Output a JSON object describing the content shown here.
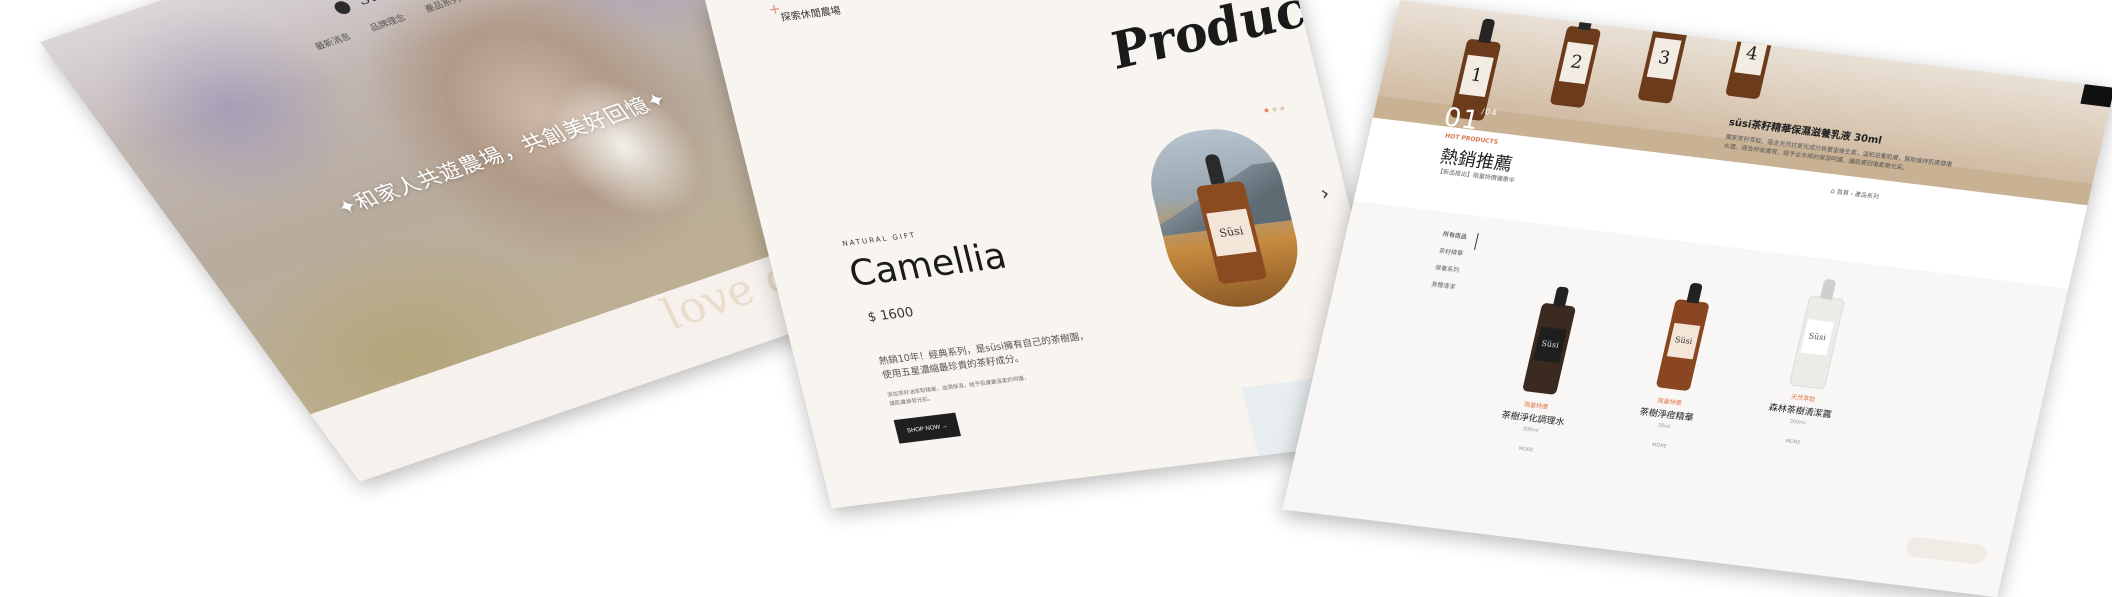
{
  "panel1": {
    "brand": "Süsi",
    "nav": [
      "最新消息",
      "品牌理念",
      "產品系列"
    ],
    "hero_text": "✦和家人共遊農場，共創美好回憶✦",
    "script_text": "love ou"
  },
  "panel2": {
    "top_link": "探索休閒農場",
    "section_title": "Product",
    "eyebrow": "NATURAL GIFT",
    "product_name": "Camellia",
    "price": "$ 1600",
    "desc_line1": "熱銷10年！經典系列，是süsi擁有自己的茶樹園，",
    "desc_line2": "使用五星濃縮最珍貴的茶籽成分。",
    "small_line1": "添加茶籽油萃取精華，滋潤保濕，給予肌膚最溫柔的呵護，",
    "small_line2": "讓肌膚煥發光彩。",
    "button_label": "SHOP NOW →",
    "bottle_label": "Süsi",
    "arrow": "›"
  },
  "panel3": {
    "banner_number": "01",
    "banner_number_sup": "/04",
    "banner_title": "süsi茶籽精華保濕滋養乳液 30ml",
    "banner_text": "獨家茶籽萃取，蘊含天然抗氧化成分與豐富維生素，溫和滋養肌膚，幫助維持肌膚健康水潤。適合所有膚質，給予全天候的保濕呵護，讓肌膚回復柔嫩光采。",
    "bottle_numbers": [
      "1",
      "2",
      "3",
      "4"
    ],
    "eyebrow": "HOT PRODUCTS",
    "heading": "熱銷推薦",
    "subheading": "【新品推出】限量特價優惠中",
    "breadcrumb": [
      "首頁",
      "›",
      "產品系列"
    ],
    "sidebar": [
      "所有商品",
      "茶籽精華",
      "保養系列",
      "身體清潔"
    ],
    "products": [
      {
        "tag": "限量特價",
        "name": "茶樹淨化調理水",
        "count": "300ml",
        "button": "MORE"
      },
      {
        "tag": "限量特價",
        "name": "茶樹淨痘精華",
        "count": "30ml",
        "button": "MORE"
      },
      {
        "tag": "天然萃取",
        "name": "森林茶樹清潔露",
        "count": "300ml",
        "button": "MORE"
      }
    ],
    "bottle_label": "Süsi"
  }
}
